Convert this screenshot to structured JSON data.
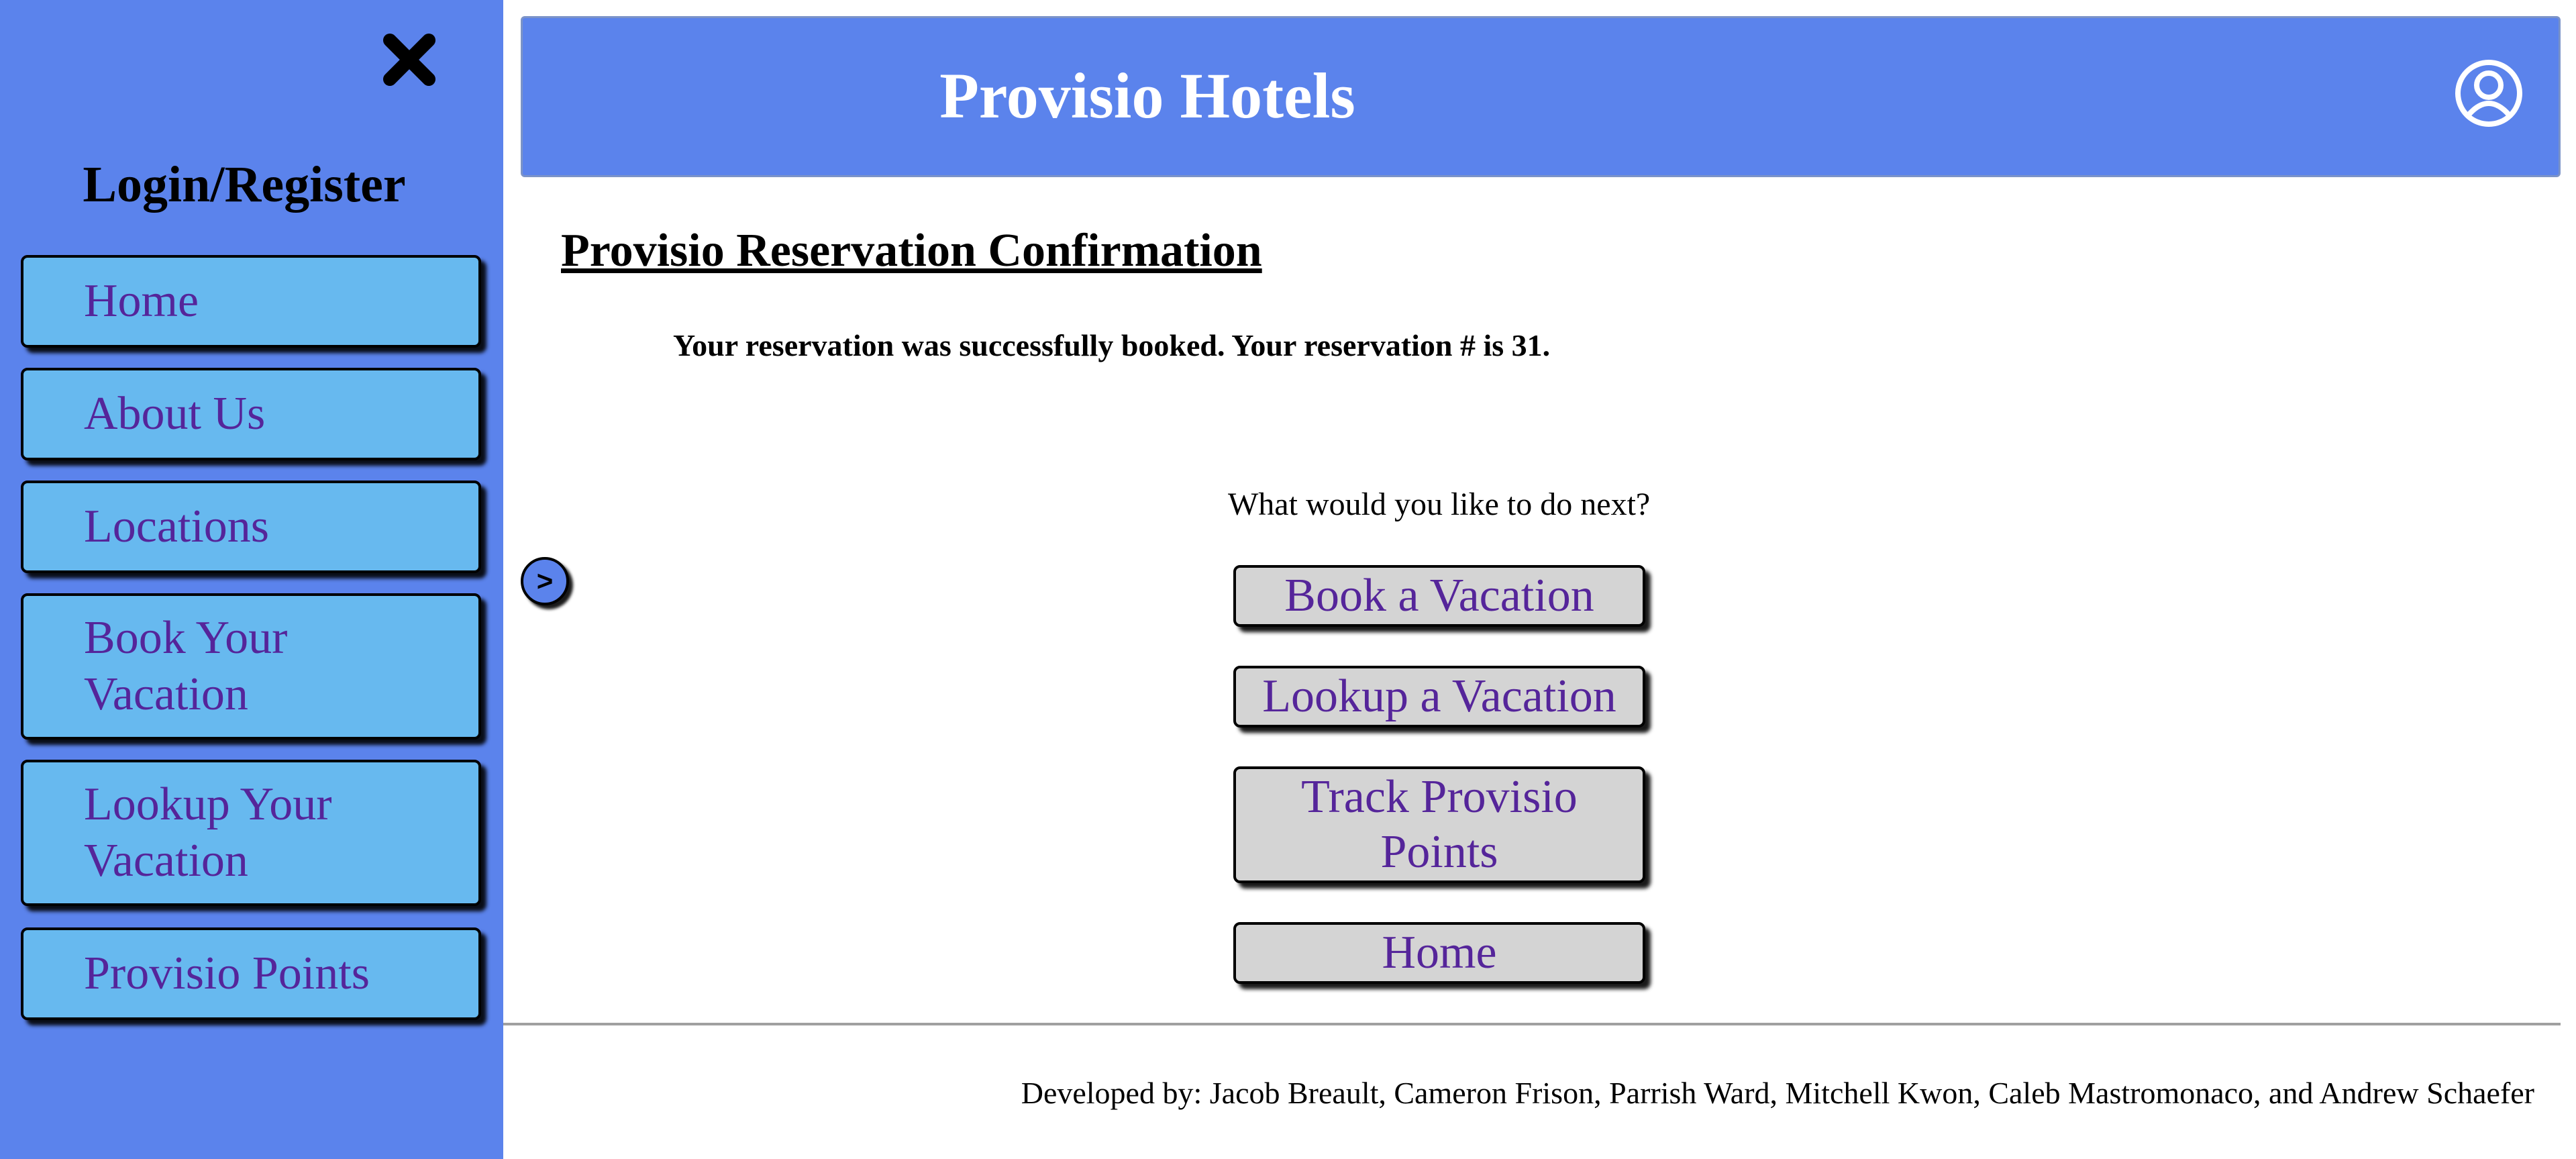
{
  "sidebar": {
    "close_icon": "close-icon",
    "login_label": "Login/Register",
    "items": [
      {
        "label": "Home"
      },
      {
        "label": "About Us"
      },
      {
        "label": "Locations"
      },
      {
        "label": "Book Your Vacation"
      },
      {
        "label": "Lookup Your Vacation"
      },
      {
        "label": "Provisio Points"
      }
    ]
  },
  "header": {
    "title": "Provisio Hotels",
    "user_icon": "user-account-icon"
  },
  "main": {
    "heading": "Provisio Reservation Confirmation",
    "message": "Your reservation was successfully booked. Your reservation # is 31.",
    "prompt": "What would you like to do next?",
    "expand_label": ">",
    "actions": [
      {
        "label": "Book a Vacation"
      },
      {
        "label": "Lookup a Vacation"
      },
      {
        "label": "Track Provisio Points"
      },
      {
        "label": "Home"
      }
    ]
  },
  "footer": {
    "credits": "Developed by: Jacob Breault, Cameron Frison, Parrish Ward, Mitchell Kwon, Caleb Mastromonaco, and Andrew Schaefer"
  },
  "colors": {
    "sidebar_bg": "#5b83ec",
    "header_bg": "#5b83ec",
    "nav_item_bg": "#67b9ef",
    "button_bg": "#d4d4d4",
    "link_text": "#55259a"
  }
}
